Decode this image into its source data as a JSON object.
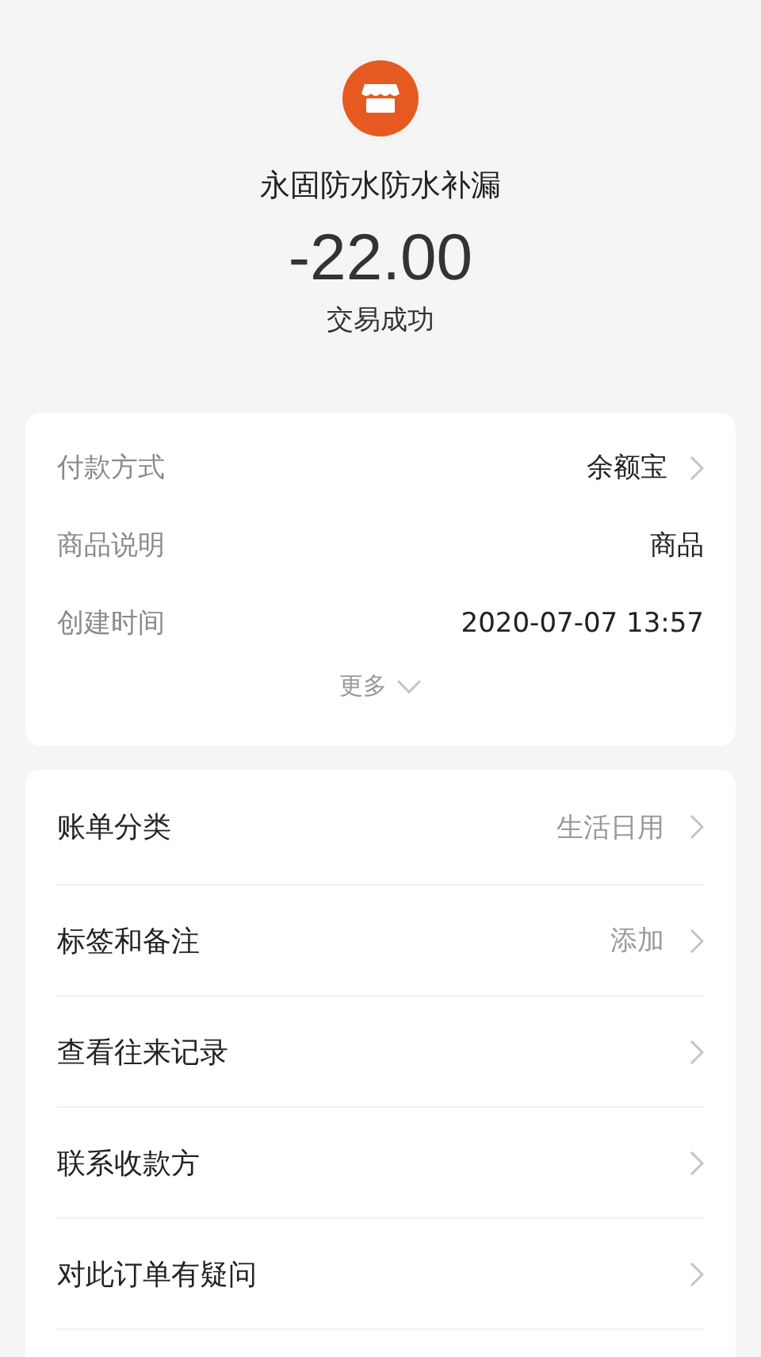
{
  "merchant": {
    "name": "永固防水防水补漏"
  },
  "amount": "-22.00",
  "status": "交易成功",
  "details": [
    {
      "label": "付款方式",
      "value": "余额宝",
      "arrow": true
    },
    {
      "label": "商品说明",
      "value": "商品",
      "arrow": false
    },
    {
      "label": "创建时间",
      "value": "2020-07-07 13:57",
      "arrow": false
    }
  ],
  "more": {
    "label": "更多",
    "expanded": false
  },
  "actions": [
    {
      "label": "账单分类",
      "value": "生活日用"
    },
    {
      "label": "标签和备注",
      "value": "添加"
    },
    {
      "label": "查看往来记录"
    },
    {
      "label": "联系收款方"
    },
    {
      "label": "对此订单有疑问"
    }
  ]
}
